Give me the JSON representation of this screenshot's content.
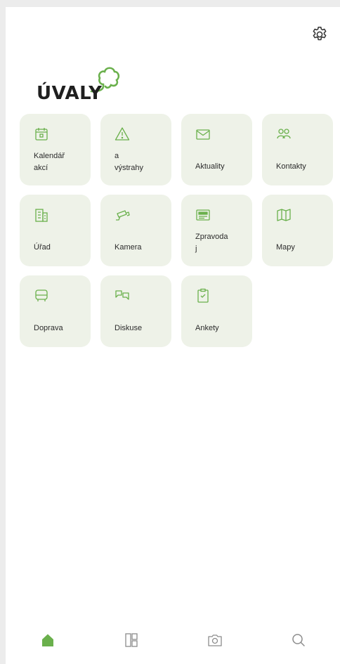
{
  "app": {
    "logo_text": "ÚVALY",
    "accent_color": "#6ab04c"
  },
  "tiles": [
    {
      "label": "Kalendář\nakcí",
      "icon": "calendar-icon"
    },
    {
      "label": "a\nvýstrahy",
      "icon": "warning-icon"
    },
    {
      "label": "Aktuality",
      "icon": "envelope-icon"
    },
    {
      "label": "Kontakty",
      "icon": "contacts-icon"
    },
    {
      "label": "Úřad",
      "icon": "building-icon"
    },
    {
      "label": "Kamera",
      "icon": "camera-icon"
    },
    {
      "label": "Zpravoda\nj",
      "icon": "newspaper-icon"
    },
    {
      "label": "Mapy",
      "icon": "map-icon"
    },
    {
      "label": "Doprava",
      "icon": "bus-icon"
    },
    {
      "label": "Diskuse",
      "icon": "discussion-icon"
    },
    {
      "label": "Ankety",
      "icon": "poll-icon"
    }
  ],
  "bottom_nav": [
    {
      "icon": "home-icon",
      "active": true
    },
    {
      "icon": "dashboard-icon",
      "active": false
    },
    {
      "icon": "camera-nav-icon",
      "active": false
    },
    {
      "icon": "search-icon",
      "active": false
    }
  ]
}
